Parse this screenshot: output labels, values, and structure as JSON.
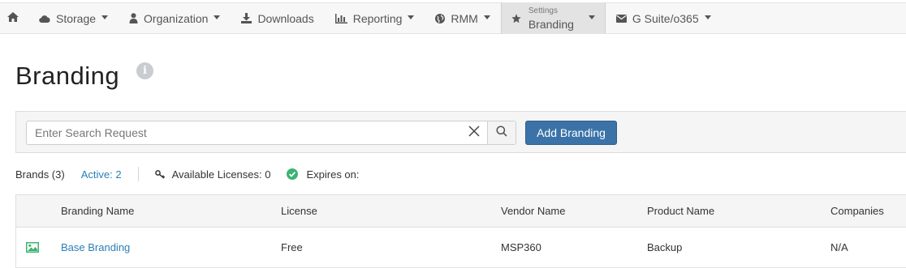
{
  "nav": {
    "items": [
      {
        "label": "Storage",
        "icon": "cloud-icon",
        "dropdown": true
      },
      {
        "label": "Organization",
        "icon": "user-icon",
        "dropdown": true
      },
      {
        "label": "Downloads",
        "icon": "download-icon",
        "dropdown": false
      },
      {
        "label": "Reporting",
        "icon": "bar-chart-icon",
        "dropdown": true
      },
      {
        "label": "RMM",
        "icon": "globe-icon",
        "dropdown": true
      }
    ],
    "active": {
      "small_label": "Settings",
      "label": "Branding",
      "icon": "star-icon"
    },
    "gsuite": {
      "label": "G Suite/o365",
      "icon": "envelope-icon"
    }
  },
  "page": {
    "title": "Branding"
  },
  "toolbar": {
    "search_placeholder": "Enter Search Request",
    "search_value": "",
    "add_label": "Add Branding"
  },
  "stats": {
    "brands": "Brands (3)",
    "active": "Active: 2",
    "licenses": "Available Licenses: 0",
    "expires": "Expires on:"
  },
  "table": {
    "columns": [
      "Branding Name",
      "License",
      "Vendor Name",
      "Product Name",
      "Companies"
    ],
    "rows": [
      {
        "name": "Base Branding",
        "license": "Free",
        "vendor": "MSP360",
        "product": "Backup",
        "companies": "N/A"
      }
    ]
  },
  "colors": {
    "primary": "#3b73a8",
    "link": "#2a7fb8",
    "success": "#3cb371",
    "navbar_bg": "#f7f7f7"
  }
}
